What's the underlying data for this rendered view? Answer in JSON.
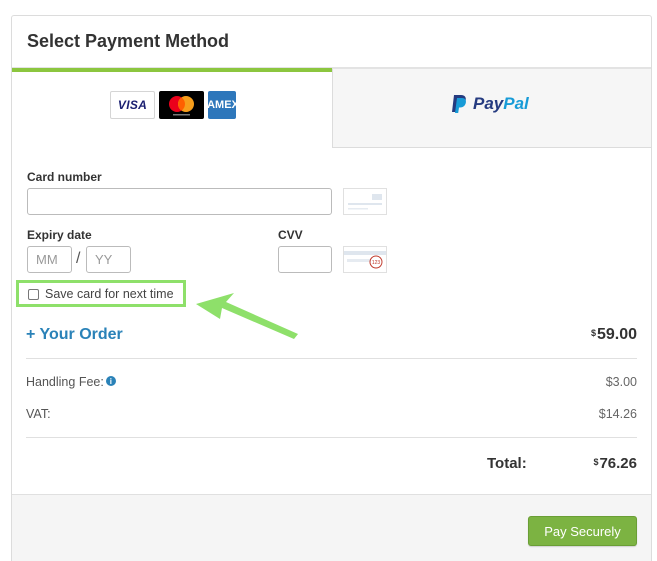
{
  "header": {
    "title": "Select Payment Method"
  },
  "tabs": {
    "card": {
      "logos": {
        "visa": "VISA",
        "amex": "AMEX"
      }
    },
    "paypal": {
      "pay": "Pay",
      "pal": "Pal"
    }
  },
  "form": {
    "card_number": {
      "label": "Card number",
      "value": ""
    },
    "expiry": {
      "label": "Expiry date",
      "month_placeholder": "MM",
      "year_placeholder": "YY",
      "separator": "/"
    },
    "cvv": {
      "label": "CVV",
      "value": "",
      "badge": "123"
    },
    "save_card": {
      "label": "Save card for next time",
      "checked": false
    }
  },
  "order": {
    "toggle_label": "+ Your Order",
    "amount_currency": "$",
    "amount": "59.00",
    "rows": [
      {
        "label": "Handling Fee:",
        "value": "$3.00",
        "info": true
      },
      {
        "label": "VAT:",
        "value": "$14.26",
        "info": false
      }
    ],
    "total_label": "Total:",
    "total_currency": "$",
    "total_amount": "76.26"
  },
  "footer": {
    "pay_button": "Pay Securely"
  },
  "colors": {
    "accent_green": "#8cc63f",
    "button_green": "#7cb342",
    "link_blue": "#2a82b8",
    "highlight_green": "#8ee06a"
  }
}
